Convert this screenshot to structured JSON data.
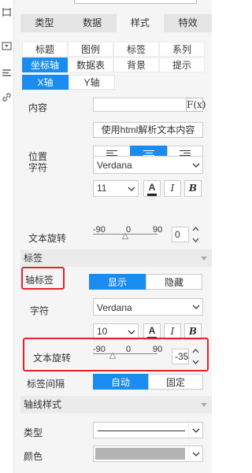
{
  "top_cut": {
    "label": "",
    "select_value": ""
  },
  "main_tabs": [
    {
      "label": "类型",
      "active": false
    },
    {
      "label": "数据",
      "active": false
    },
    {
      "label": "样式",
      "active": true
    },
    {
      "label": "特效",
      "active": false
    }
  ],
  "sub_tabs": [
    [
      {
        "label": "标题"
      },
      {
        "label": "图例"
      },
      {
        "label": "标签"
      },
      {
        "label": "系列"
      }
    ],
    [
      {
        "label": "坐标轴",
        "active": true
      },
      {
        "label": "数据表"
      },
      {
        "label": "背景"
      },
      {
        "label": "提示"
      }
    ]
  ],
  "axis_tabs": [
    {
      "label": "X轴",
      "active": true
    },
    {
      "label": "Y轴",
      "active": false
    }
  ],
  "content": {
    "label": "内容",
    "value": "",
    "fx_label": "F(x)"
  },
  "html_button": "使用html解析文本内容",
  "position": {
    "label": "位置",
    "options": [
      "left-align-icon",
      "center-align-icon",
      "right-align-icon"
    ],
    "selected": 1
  },
  "char1": {
    "label": "字符",
    "font": "Verdana",
    "size": "11",
    "color_glyph": "A",
    "italic": "I",
    "bold": "B"
  },
  "rotate1": {
    "label": "文本旋转",
    "ticks": [
      "-90",
      "0",
      "90"
    ],
    "value": "0",
    "slider_value": 0
  },
  "label_section": {
    "title": "标签"
  },
  "axis_label": {
    "label": "轴标签",
    "show": "显示",
    "hide": "隐藏",
    "selected": "show"
  },
  "char2": {
    "label": "字符",
    "font": "Verdana",
    "size": "10",
    "color_glyph": "A",
    "italic": "I",
    "bold": "B"
  },
  "rotate2": {
    "label": "文本旋转",
    "ticks": [
      "-90",
      "0",
      "90"
    ],
    "value": "-35",
    "slider_value": -35
  },
  "label_spacing": {
    "label": "标签间隔",
    "auto": "自动",
    "fixed": "固定",
    "selected": "auto"
  },
  "axisline_section": {
    "title": "轴线样式"
  },
  "line_type": {
    "label": "类型"
  },
  "line_color": {
    "label": "颜色",
    "color": "#b3b3b3"
  },
  "colors": {
    "accent": "#1a8cf0",
    "highlight": "#e0252b"
  }
}
